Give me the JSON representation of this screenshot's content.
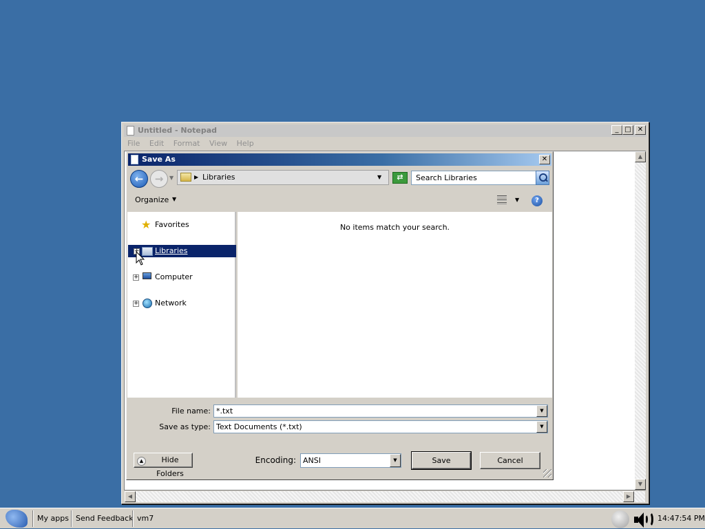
{
  "notepad": {
    "title": "Untitled - Notepad",
    "menu": [
      "File",
      "Edit",
      "Format",
      "View",
      "Help"
    ]
  },
  "dialog": {
    "title": "Save As",
    "address": "Libraries",
    "search_placeholder": "Search Libraries",
    "organize_label": "Organize",
    "empty_message": "No items match your search.",
    "tree": {
      "favorites": "Favorites",
      "libraries": "Libraries",
      "computer": "Computer",
      "network": "Network"
    },
    "file_name_label": "File name:",
    "file_name_value": "*.txt",
    "save_as_type_label": "Save as type:",
    "save_as_type_value": "Text Documents (*.txt)",
    "encoding_label": "Encoding:",
    "encoding_value": "ANSI",
    "hide_folders_label": "Hide Folders",
    "save_label": "Save",
    "cancel_label": "Cancel"
  },
  "taskbar": {
    "my_apps": "My apps",
    "send_feedback": "Send Feedback",
    "vm": "vm7",
    "clock": "14:47:54 PM"
  },
  "colors": {
    "desktop": "#3a6ea5",
    "title_active": "#0a246a",
    "selection": "#0a246a"
  }
}
